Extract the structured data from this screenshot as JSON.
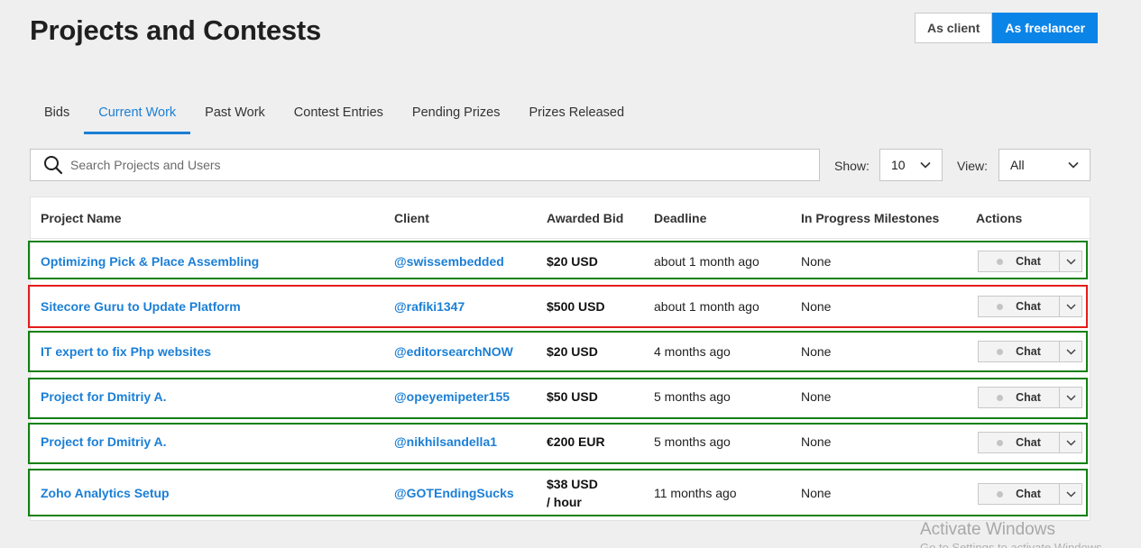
{
  "page": {
    "title": "Projects and Contests"
  },
  "role_toggle": {
    "client_label": "As client",
    "freelancer_label": "As freelancer",
    "active": "freelancer"
  },
  "tabs": [
    {
      "label": "Bids"
    },
    {
      "label": "Current Work",
      "active": true
    },
    {
      "label": "Past Work"
    },
    {
      "label": "Contest Entries"
    },
    {
      "label": "Pending Prizes"
    },
    {
      "label": "Prizes Released"
    }
  ],
  "search": {
    "placeholder": "Search Projects and Users",
    "value": ""
  },
  "filters": {
    "show_label": "Show:",
    "show_value": "10",
    "view_label": "View:",
    "view_value": "All"
  },
  "table": {
    "columns": [
      "Project Name",
      "Client",
      "Awarded Bid",
      "Deadline",
      "In Progress Milestones",
      "Actions"
    ],
    "rows": [
      {
        "project": "Optimizing Pick & Place Assembling",
        "client": "@swissembedded",
        "bid": "$20 USD",
        "bid_unit": "",
        "deadline": "about 1 month ago",
        "milestones": "None",
        "action": "Chat",
        "highlight": "green"
      },
      {
        "project": "Sitecore Guru to Update Platform",
        "client": "@rafiki1347",
        "bid": "$500 USD",
        "bid_unit": "",
        "deadline": "about 1 month ago",
        "milestones": "None",
        "action": "Chat",
        "highlight": "red"
      },
      {
        "project": "IT expert to fix Php websites",
        "client": "@editorsearchNOW",
        "bid": "$20 USD",
        "bid_unit": "",
        "deadline": "4 months ago",
        "milestones": "None",
        "action": "Chat",
        "highlight": "green"
      },
      {
        "project": "Project for Dmitriy A.",
        "client": "@opeyemipeter155",
        "bid": "$50 USD",
        "bid_unit": "",
        "deadline": "5 months ago",
        "milestones": "None",
        "action": "Chat",
        "highlight": "green"
      },
      {
        "project": "Project for Dmitriy A.",
        "client": "@nikhilsandella1",
        "bid": "€200 EUR",
        "bid_unit": "",
        "deadline": "5 months ago",
        "milestones": "None",
        "action": "Chat",
        "highlight": "green"
      },
      {
        "project": "Zoho Analytics Setup",
        "client": "@GOTEndingSucks",
        "bid": "$38 USD",
        "bid_unit": "/ hour",
        "deadline": "11 months ago",
        "milestones": "None",
        "action": "Chat",
        "highlight": "green"
      }
    ]
  },
  "watermark": {
    "title": "Activate Windows",
    "subtitle": "Go to Settings to activate Windows."
  },
  "colors": {
    "accent": "#0b84e8",
    "link": "#1b7fd6",
    "highlight_green": "#118111",
    "highlight_red": "#e51c1c"
  },
  "icons": {
    "search": "search-icon",
    "dropdown": "chevron-down-icon"
  }
}
